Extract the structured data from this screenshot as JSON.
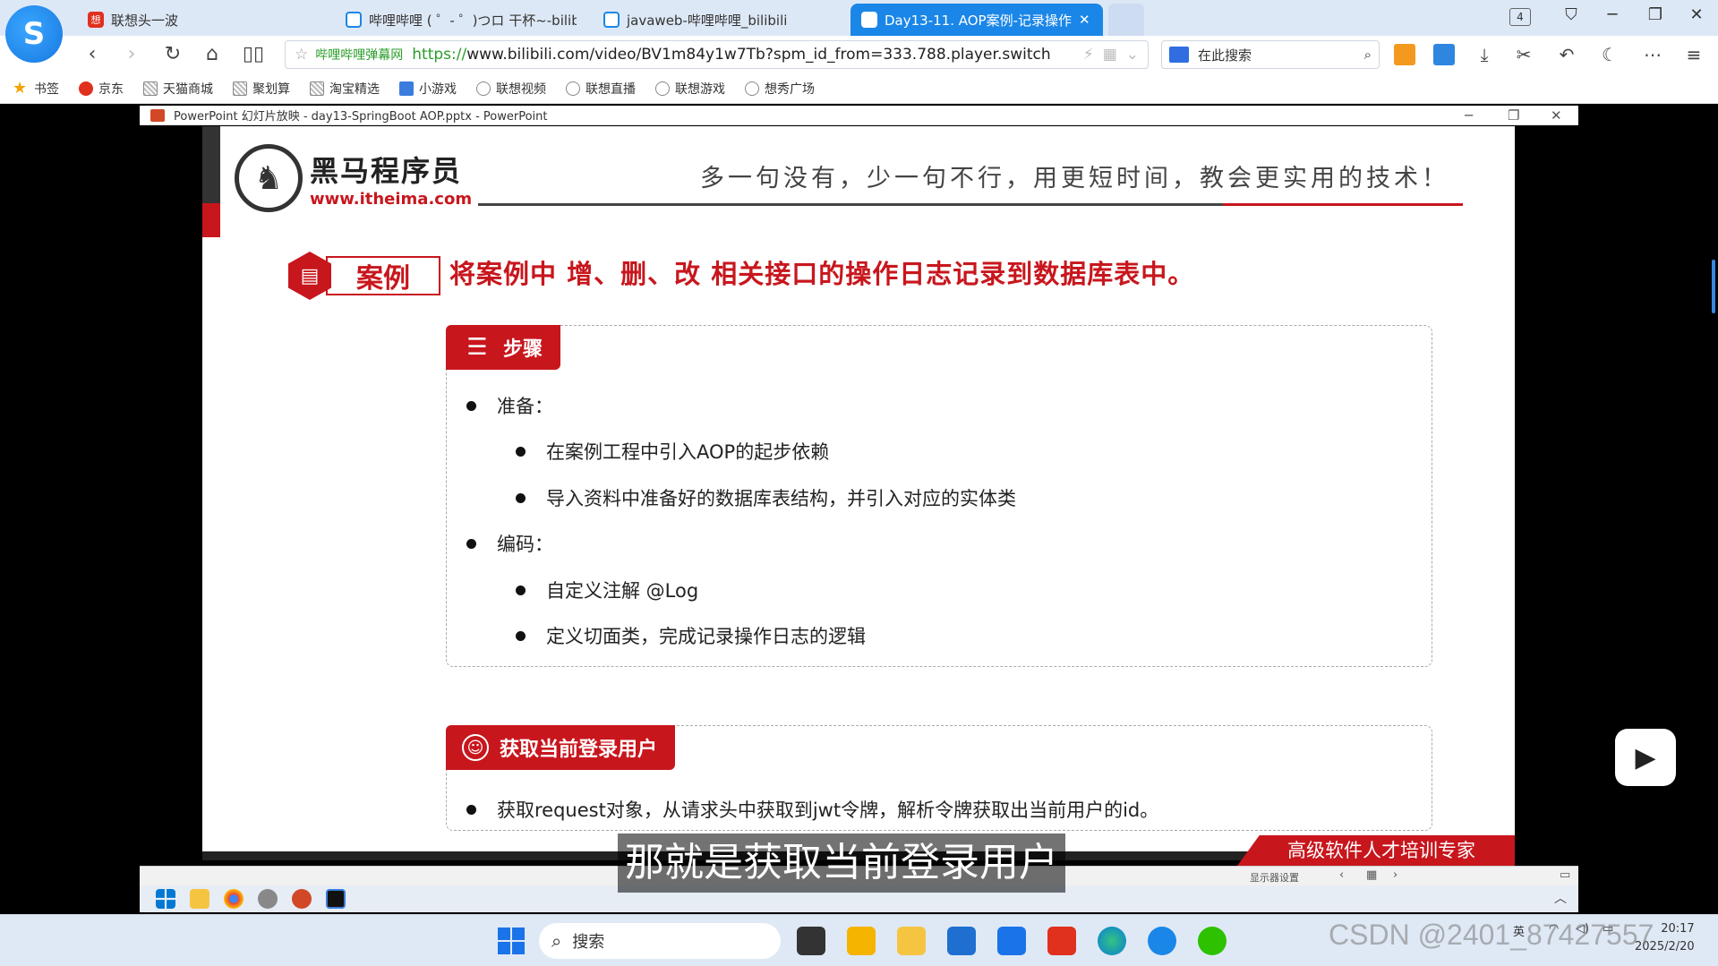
{
  "browser": {
    "tabs": [
      {
        "label": "联想头一波"
      },
      {
        "label": "哔哩哔哩 ( ゜- ゜)つロ 干杯~-bilib"
      },
      {
        "label": "javaweb-哔哩哔哩_bilibili"
      },
      {
        "label": "Day13-11. AOP案例-记录操作"
      }
    ],
    "tab_count": "4",
    "address": {
      "site_label": "哔哩哔哩弹幕网",
      "https": "https://",
      "url_rest": "www.bilibili.com/video/BV1m84y1w7Tb?spm_id_from=333.788.player.switch"
    },
    "search_placeholder": "在此搜索",
    "bookmarks": [
      "书签",
      "京东",
      "天猫商城",
      "聚划算",
      "淘宝精选",
      "小游戏",
      "联想视频",
      "联想直播",
      "联想游戏",
      "想秀广场"
    ]
  },
  "ppt": {
    "window_title": "PowerPoint 幻灯片放映  -  day13-SpringBoot AOP.pptx - PowerPoint",
    "status_text": "显示器设置",
    "slide": {
      "logo_cn": "黑马程序员",
      "logo_en": "www.itheima.com",
      "motto": "多一句没有，少一句不行，用更短时间，教会更实用的技术！",
      "case_label": "案例",
      "case_title": "将案例中 增、删、改 相关接口的操作日志记录到数据库表中。",
      "steps": {
        "header": "步骤",
        "items": [
          {
            "text": "准备："
          },
          {
            "text": "在案例工程中引入AOP的起步依赖"
          },
          {
            "text": "导入资料中准备好的数据库表结构，并引入对应的实体类"
          },
          {
            "text": "编码："
          },
          {
            "text": "自定义注解 @Log"
          },
          {
            "text": "定义切面类，完成记录操作日志的逻辑"
          }
        ]
      },
      "user": {
        "header": "获取当前登录用户",
        "item": "获取request对象，从请求头中获取到jwt令牌，解析令牌获取出当前用户的id。"
      },
      "banner": "高级软件人才培训专家"
    }
  },
  "video": {
    "subtitle": "那就是获取当前登录用户"
  },
  "taskbar": {
    "search_label": "搜索",
    "clock_time": "20:17",
    "clock_date": "2025/2/20",
    "ime": "英"
  },
  "watermark": "CSDN @2401_87427557",
  "colors": {
    "accent_red": "#c8161d",
    "browser_blue": "#1a86e8"
  }
}
